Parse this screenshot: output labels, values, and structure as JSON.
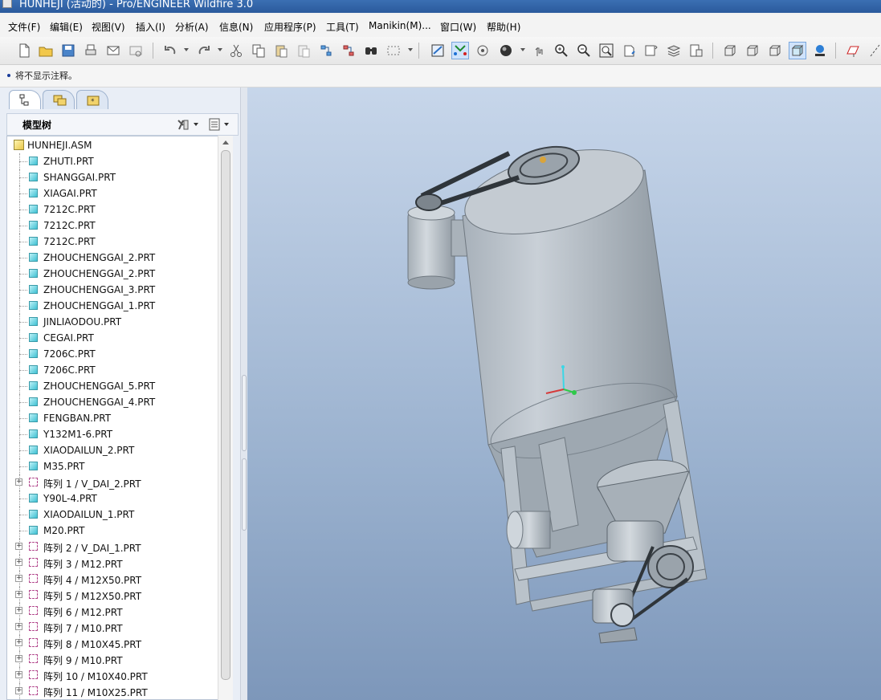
{
  "window": {
    "title": "HUNHEJI (活动的) - Pro/ENGINEER Wildfire 3.0"
  },
  "menu": [
    "文件(F)",
    "编辑(E)",
    "视图(V)",
    "插入(I)",
    "分析(A)",
    "信息(N)",
    "应用程序(P)",
    "工具(T)",
    "Manikin(M)...",
    "窗口(W)",
    "帮助(H)"
  ],
  "status": {
    "message": "将不显示注释。"
  },
  "navigator": {
    "tabs": [
      "model-tree-tab",
      "layers-tab",
      "favorites-tab"
    ],
    "tree_title": "模型树",
    "root": "HUNHEJI.ASM",
    "items": [
      {
        "label": "ZHUTI.PRT",
        "icon": "part",
        "expand": false
      },
      {
        "label": "SHANGGAI.PRT",
        "icon": "part",
        "expand": false
      },
      {
        "label": "XIAGAI.PRT",
        "icon": "part",
        "expand": false
      },
      {
        "label": "7212C.PRT",
        "icon": "part",
        "expand": false
      },
      {
        "label": "7212C.PRT",
        "icon": "part",
        "expand": false
      },
      {
        "label": "7212C.PRT",
        "icon": "part",
        "expand": false
      },
      {
        "label": "ZHOUCHENGGAI_2.PRT",
        "icon": "part",
        "expand": false
      },
      {
        "label": "ZHOUCHENGGAI_2.PRT",
        "icon": "part",
        "expand": false
      },
      {
        "label": "ZHOUCHENGGAI_3.PRT",
        "icon": "part",
        "expand": false
      },
      {
        "label": "ZHOUCHENGGAI_1.PRT",
        "icon": "part",
        "expand": false
      },
      {
        "label": "JINLIAODOU.PRT",
        "icon": "part",
        "expand": false
      },
      {
        "label": "CEGAI.PRT",
        "icon": "part",
        "expand": false
      },
      {
        "label": "7206C.PRT",
        "icon": "part",
        "expand": false
      },
      {
        "label": "7206C.PRT",
        "icon": "part",
        "expand": false
      },
      {
        "label": "ZHOUCHENGGAI_5.PRT",
        "icon": "part",
        "expand": false
      },
      {
        "label": "ZHOUCHENGGAI_4.PRT",
        "icon": "part",
        "expand": false
      },
      {
        "label": "FENGBAN.PRT",
        "icon": "part",
        "expand": false
      },
      {
        "label": "Y132M1-6.PRT",
        "icon": "part",
        "expand": false
      },
      {
        "label": "XIAODAILUN_2.PRT",
        "icon": "part",
        "expand": false
      },
      {
        "label": "M35.PRT",
        "icon": "part",
        "expand": false
      },
      {
        "label": "阵列 1 / V_DAI_2.PRT",
        "icon": "pattern",
        "expand": true
      },
      {
        "label": "Y90L-4.PRT",
        "icon": "part",
        "expand": false
      },
      {
        "label": "XIAODAILUN_1.PRT",
        "icon": "part",
        "expand": false
      },
      {
        "label": "M20.PRT",
        "icon": "part",
        "expand": false
      },
      {
        "label": "阵列 2 / V_DAI_1.PRT",
        "icon": "pattern",
        "expand": true
      },
      {
        "label": "阵列 3 / M12.PRT",
        "icon": "pattern",
        "expand": true
      },
      {
        "label": "阵列 4 / M12X50.PRT",
        "icon": "pattern",
        "expand": true
      },
      {
        "label": "阵列 5 / M12X50.PRT",
        "icon": "pattern",
        "expand": true
      },
      {
        "label": "阵列 6 / M12.PRT",
        "icon": "pattern",
        "expand": true
      },
      {
        "label": "阵列 7 / M10.PRT",
        "icon": "pattern",
        "expand": true
      },
      {
        "label": "阵列 8 / M10X45.PRT",
        "icon": "pattern",
        "expand": true
      },
      {
        "label": "阵列 9 / M10.PRT",
        "icon": "pattern",
        "expand": true
      },
      {
        "label": "阵列 10 / M10X40.PRT",
        "icon": "pattern",
        "expand": true
      },
      {
        "label": "阵列 11 / M10X25.PRT",
        "icon": "pattern",
        "expand": true
      }
    ]
  },
  "toolbar": {
    "icons": [
      "new-icon",
      "open-icon",
      "save-icon",
      "print-icon",
      "send-mail-icon",
      "send-mail-link-icon",
      "undo-icon",
      "redo-icon",
      "cut-icon",
      "copy-icon",
      "paste-icon",
      "paste-special-icon",
      "regenerate-icon",
      "regen-manager-icon",
      "find-icon",
      "select-box-icon",
      "refit-view-icon",
      "datum-display-icon",
      "orient-icon",
      "appearance-icon",
      "spin-center-icon",
      "zoom-in-icon",
      "zoom-out-icon",
      "zoom-fit-icon",
      "reorient-icon",
      "saved-views-icon",
      "layers-icon",
      "view-manager-icon",
      "wireframe-icon",
      "hidden-line-icon",
      "no-hidden-icon",
      "shading-icon",
      "enhanced-realism-icon",
      "datum-plane-icon",
      "datum-axis-icon"
    ]
  },
  "colors": {
    "viewport_top": "#c7d6ea",
    "viewport_bottom": "#7d97ba",
    "model_gray": "#b3bcc4",
    "selected_tab": "#ffffff"
  }
}
